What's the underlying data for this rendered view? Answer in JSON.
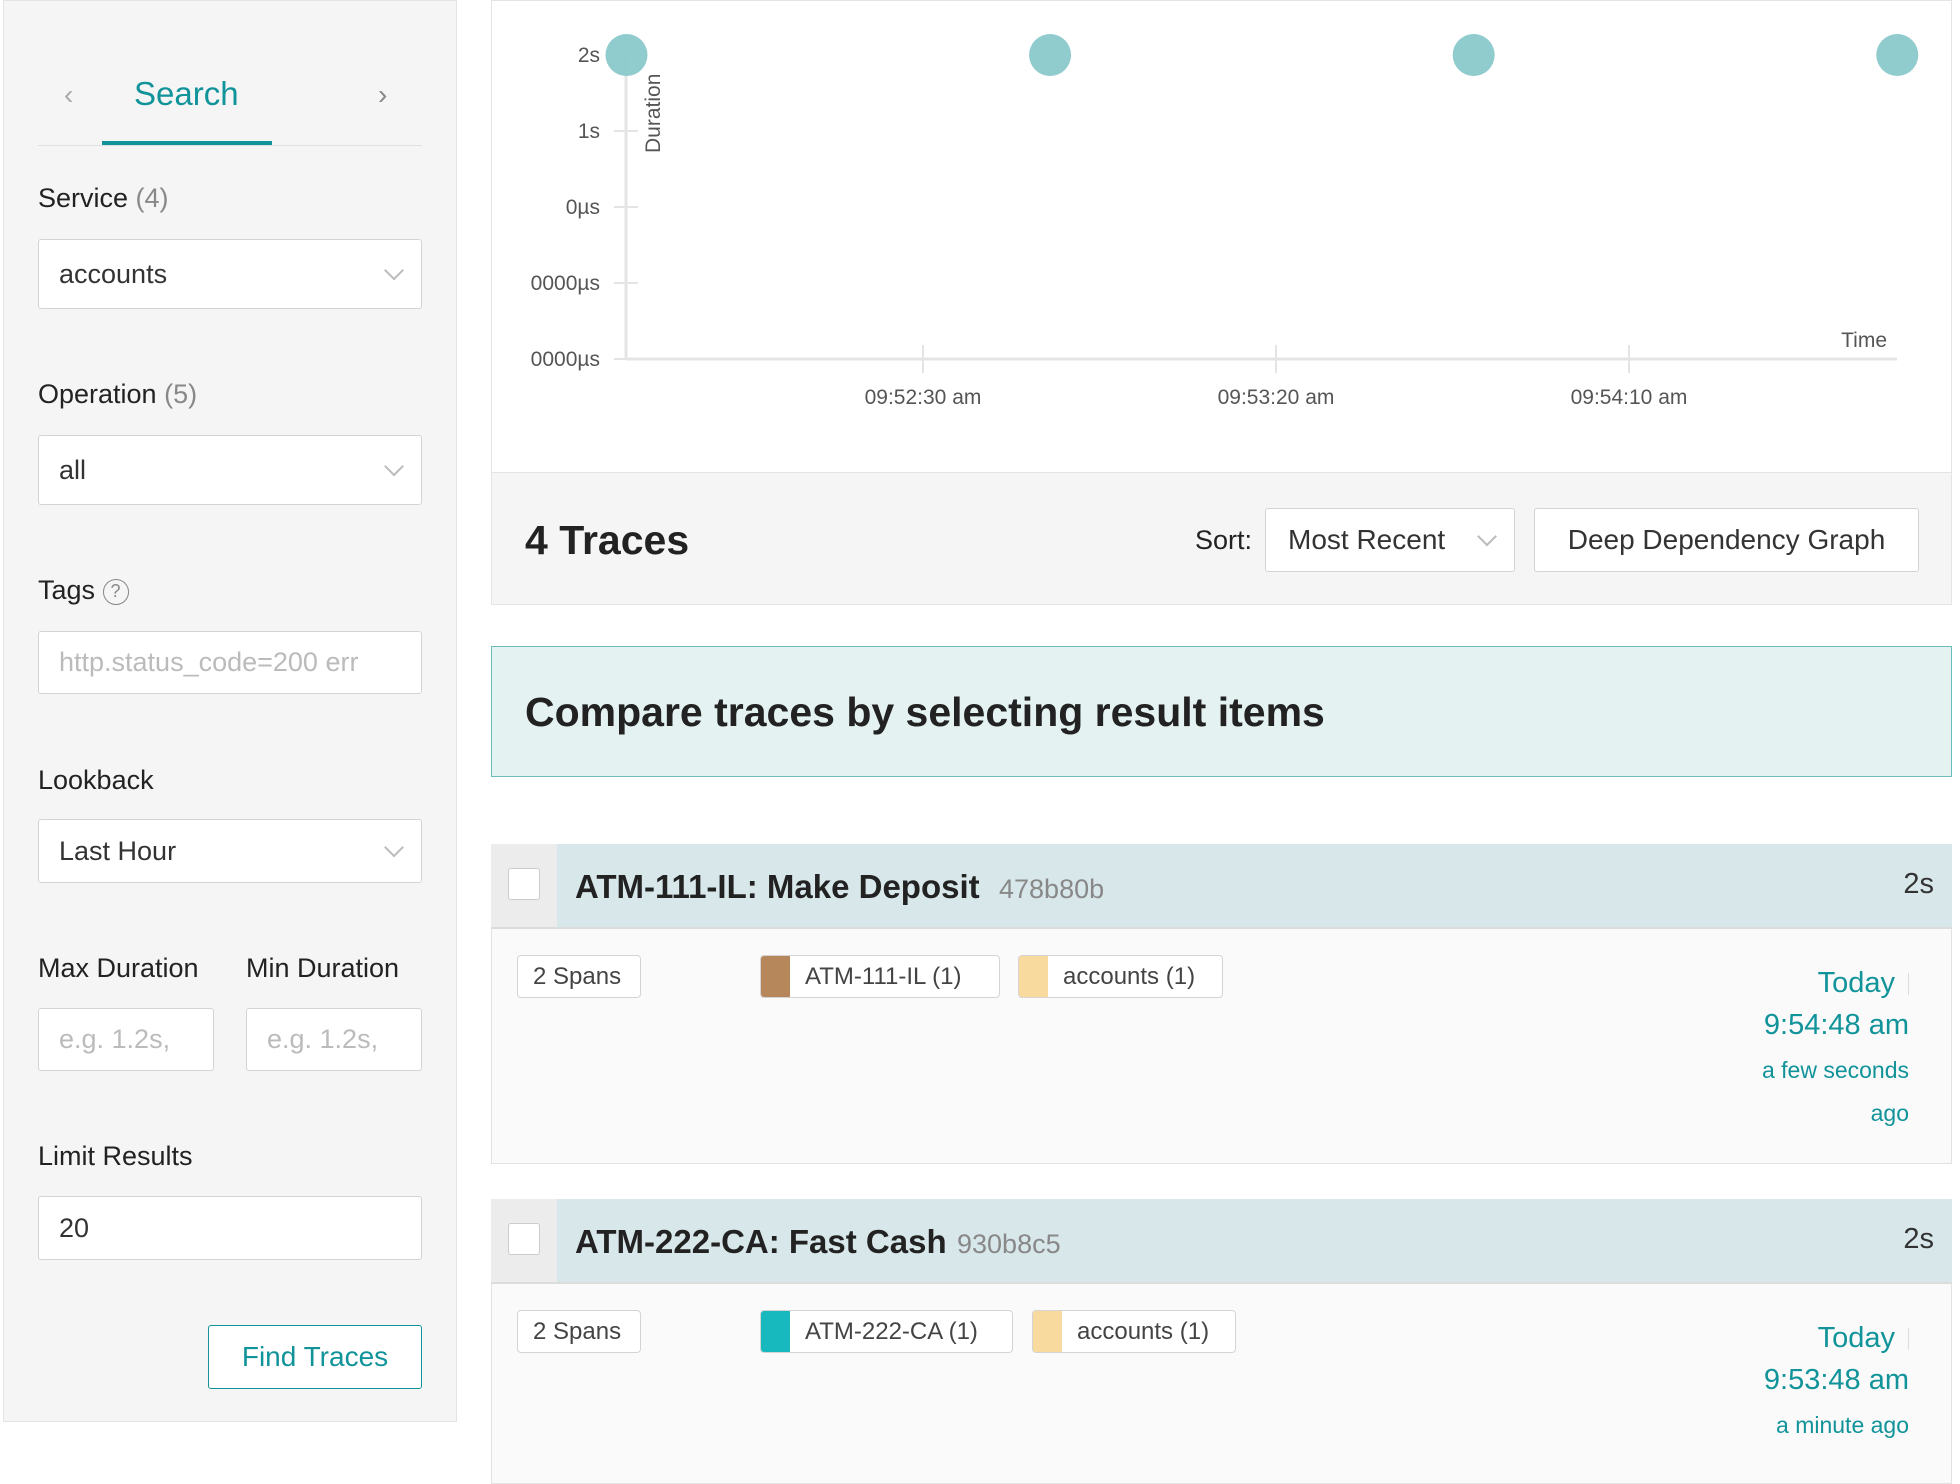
{
  "sidebar": {
    "tab": "Search",
    "service": {
      "label": "Service",
      "count": "(4)",
      "value": "accounts"
    },
    "operation": {
      "label": "Operation",
      "count": "(5)",
      "value": "all"
    },
    "tags": {
      "label": "Tags",
      "placeholder": "http.status_code=200 err"
    },
    "lookback": {
      "label": "Lookback",
      "value": "Last Hour"
    },
    "max_duration": {
      "label": "Max Duration",
      "placeholder": "e.g. 1.2s,"
    },
    "min_duration": {
      "label": "Min Duration",
      "placeholder": "e.g. 1.2s,"
    },
    "limit": {
      "label": "Limit Results",
      "value": "20"
    },
    "find_button": "Find Traces"
  },
  "chart_data": {
    "type": "scatter",
    "xlabel": "Time",
    "ylabel": "Duration",
    "y_ticks": [
      "2s",
      "1s",
      "0µs",
      "0000µs",
      "0000µs"
    ],
    "x_ticks": [
      "09:52:30 am",
      "09:53:20 am",
      "09:54:10 am"
    ],
    "points": [
      {
        "x": "09:51:48",
        "y": 2
      },
      {
        "x": "09:52:48",
        "y": 2
      },
      {
        "x": "09:53:48",
        "y": 2
      },
      {
        "x": "09:54:48",
        "y": 2
      }
    ],
    "point_color": "#8ac8cb"
  },
  "results": {
    "count_label": "4 Traces",
    "sort_label": "Sort:",
    "sort_value": "Most Recent",
    "ddg_button": "Deep Dependency Graph"
  },
  "banner": "Compare traces by selecting result items",
  "traces": [
    {
      "title": "ATM-111-IL: Make Deposit",
      "id": "478b80b",
      "duration": "2s",
      "spans": "2 Spans",
      "services": [
        {
          "name": "ATM-111-IL (1)",
          "color": "#b5875a"
        },
        {
          "name": "accounts (1)",
          "color": "#f8d99e"
        }
      ],
      "day": "Today",
      "time": "9:54:48 am",
      "ago": [
        "a few seconds",
        "ago"
      ]
    },
    {
      "title": "ATM-222-CA: Fast Cash",
      "id": "930b8c5",
      "duration": "2s",
      "spans": "2 Spans",
      "services": [
        {
          "name": "ATM-222-CA (1)",
          "color": "#17b8be"
        },
        {
          "name": "accounts (1)",
          "color": "#f8d99e"
        }
      ],
      "day": "Today",
      "time": "9:53:48 am",
      "ago": [
        "a minute ago"
      ]
    }
  ]
}
